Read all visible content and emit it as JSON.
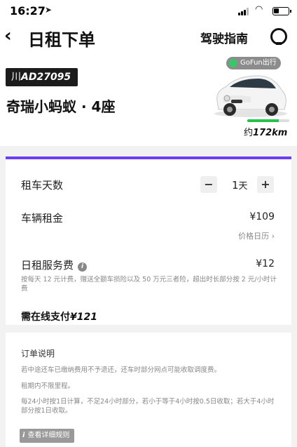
{
  "status_bar": {
    "time": "16:27"
  },
  "nav": {
    "back": "‹",
    "title": "日租下单",
    "guide": "驾驶指南"
  },
  "vehicle": {
    "plate_prefix": "川",
    "plate_number": "AD27095",
    "name": "奇瑞小蚂蚁 · 4座",
    "brand_tag": "GoFun出行",
    "range_prefix": "约",
    "range_value": "172km",
    "range_level": 0.75,
    "accent_color": "#27c14b"
  },
  "order": {
    "accent_color": "#6b3ef0",
    "days_label": "租车天数",
    "minus": "−",
    "days_value": "1",
    "days_unit": "天",
    "plus": "+",
    "rent_label": "车辆租金",
    "rent_value": "¥109",
    "calendar_link": "价格日历",
    "calendar_arrow": "›",
    "service_label": "日租服务费",
    "service_value": "¥12",
    "service_desc": "按每天 12 元计费，赠送全额车损险以及 50 万元三者险，超出时长部分按 2 元/小时计费",
    "total_prefix": "需在线支付",
    "total_value": "¥121"
  },
  "notes": {
    "title": "订单说明",
    "items": [
      "若中途还车已缴纳费用不予退还，还车时部分网点可能收取调度费。",
      "租期内不限里程。",
      "每24小时按1日计算，不足24小时部分，若小于等于4小时按0.5日收取；若大于4小时部分按1日收取。"
    ],
    "rules_button": "查看详细规则"
  }
}
